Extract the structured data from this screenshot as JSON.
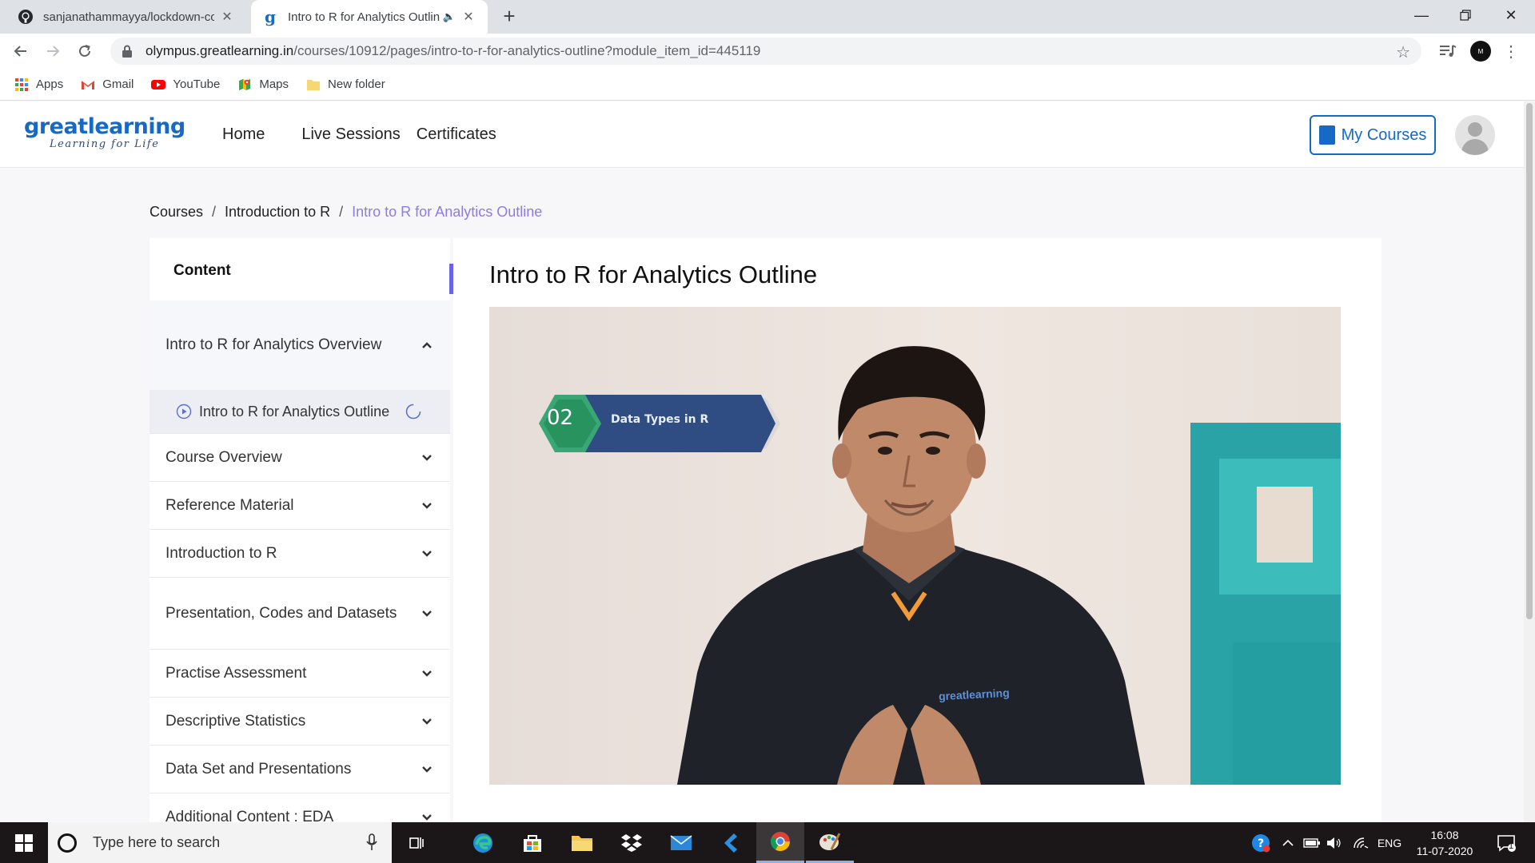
{
  "browser": {
    "tabs": [
      {
        "title": "sanjanathammayya/lockdown-co"
      },
      {
        "title": "Intro to R for Analytics Outlin"
      }
    ],
    "url_main": "olympus.greatlearning.in",
    "url_path": "/courses/10912/pages/intro-to-r-for-analytics-outline?module_item_id=445119",
    "profile_initials": "M",
    "bookmarks": [
      {
        "label": "Apps",
        "icon": "apps-grid-icon"
      },
      {
        "label": "Gmail",
        "icon": "gmail-icon"
      },
      {
        "label": "YouTube",
        "icon": "youtube-icon"
      },
      {
        "label": "Maps",
        "icon": "maps-icon"
      },
      {
        "label": "New folder",
        "icon": "folder-icon"
      }
    ]
  },
  "site": {
    "logo_main": "greatlearning",
    "logo_tagline": "Learning for Life",
    "nav": [
      "Home",
      "Live Sessions",
      "Certificates"
    ],
    "my_courses_label": "My Courses",
    "brand_color": "#1769c6",
    "accent_color": "#6a63e6"
  },
  "breadcrumb": {
    "items": [
      "Courses",
      "Introduction to R"
    ],
    "current": "Intro to R for Analytics Outline",
    "separator": "/"
  },
  "sidebar": {
    "heading": "Content",
    "toggle_icon": "«",
    "open_section": "Intro to R for Analytics Overview",
    "open_item": "Intro to R for Analytics Outline",
    "sections": [
      "Course Overview",
      "Reference Material",
      "Introduction to R",
      "Presentation, Codes and Datasets",
      "Practise Assessment",
      "Descriptive Statistics",
      "Data Set and Presentations",
      "Additional Content : EDA"
    ]
  },
  "main": {
    "title": "Intro to R for Analytics Outline",
    "video": {
      "badge_number": "02",
      "badge_text": "Data Types in R",
      "shirt_logo": "greatlearning"
    }
  },
  "taskbar": {
    "search_placeholder": "Type here to search",
    "language": "ENG",
    "time": "16:08",
    "date": "11-07-2020",
    "notification_count": "1"
  }
}
